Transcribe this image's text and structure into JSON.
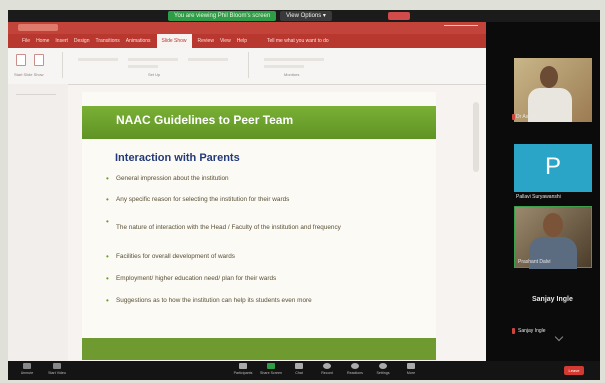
{
  "share_bar": {
    "status": "You are viewing Phil Bloom's screen",
    "view_options": "View Options ▾"
  },
  "powerpoint": {
    "ribbon_tabs": [
      "File",
      "Home",
      "Insert",
      "Design",
      "Transitions",
      "Animations",
      "Slide Show",
      "Review",
      "View",
      "Help"
    ],
    "active_tab": "Slide Show",
    "tell_me": "Tell me what you want to do",
    "ribbon_groups": [
      "Start Slide Show",
      "Set Up",
      "Monitors"
    ]
  },
  "slide": {
    "title": "NAAC Guidelines to Peer Team",
    "subtitle": "Interaction with Parents",
    "bullets": [
      "General impression about the institution",
      "Any specific reason for selecting the institution for their wards",
      "The nature of interaction with the Head / Faculty of the institution and frequency",
      "Facilities for overall development of wards",
      "Employment/ higher education need/ plan for their wards",
      "Suggestions as to how the institution can help its students even more"
    ],
    "colors": {
      "header_green": "#7ab035",
      "subtitle_blue": "#243a78",
      "footer_green": "#6e9a30"
    }
  },
  "participants": {
    "tiles": [
      {
        "name": "Dr Ashok",
        "type": "video",
        "icon": "person-video"
      },
      {
        "name": "Pallavi Suryawanshi",
        "type": "avatar",
        "letter": "P",
        "avatar_color": "#2aa5c7"
      },
      {
        "name": "Prashant Dalvi",
        "type": "video",
        "icon": "person-video"
      }
    ],
    "speaker": "Sanjay Ingle",
    "speaker_caption": "Sanjay Ingle"
  },
  "toolbar": {
    "items": [
      {
        "label": "Unmute",
        "icon": "mic-icon"
      },
      {
        "label": "Start Video",
        "icon": "video-icon"
      },
      {
        "label": "Participants",
        "icon": "participants-icon"
      },
      {
        "label": "Share Screen",
        "icon": "share-screen-icon"
      },
      {
        "label": "Chat",
        "icon": "chat-icon"
      },
      {
        "label": "Record",
        "icon": "record-icon"
      },
      {
        "label": "Reactions",
        "icon": "reactions-icon"
      },
      {
        "label": "Settings",
        "icon": "settings-icon"
      },
      {
        "label": "More",
        "icon": "more-icon"
      }
    ],
    "end_label": "Leave",
    "share_accent": "#2f9d47",
    "end_color": "#d23a32"
  }
}
